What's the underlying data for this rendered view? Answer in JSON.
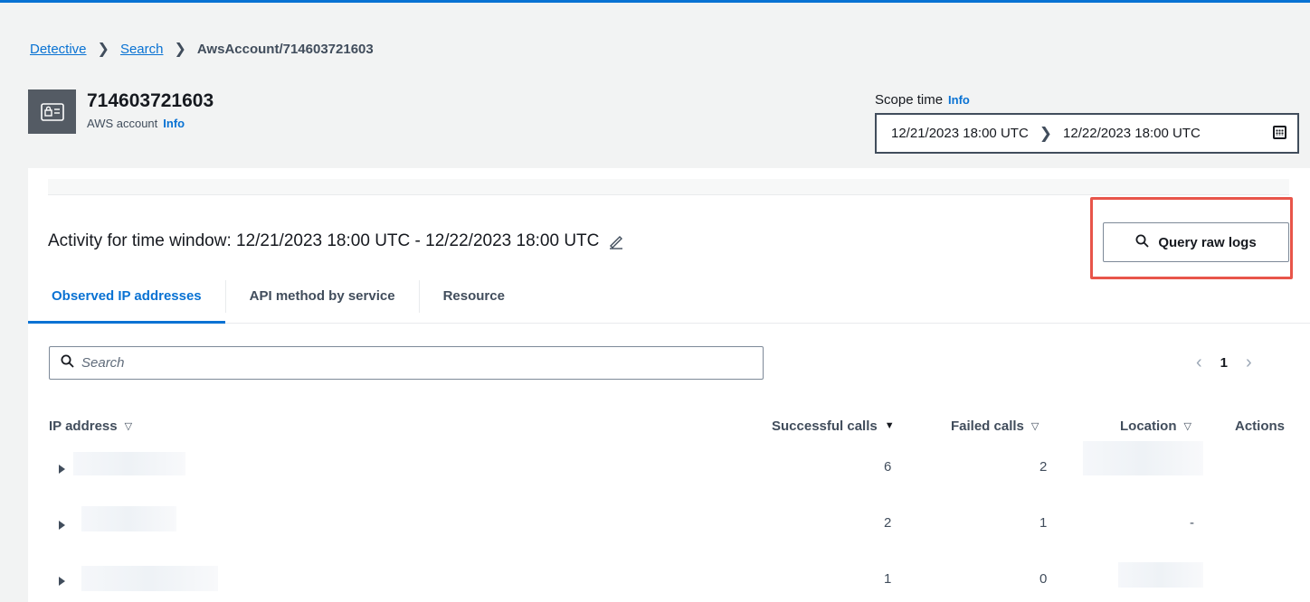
{
  "breadcrumb": {
    "items": [
      "Detective",
      "Search",
      "AwsAccount/714603721603"
    ]
  },
  "account": {
    "id": "714603721603",
    "type_label": "AWS account",
    "info_label": "Info"
  },
  "scope": {
    "label": "Scope time",
    "info_label": "Info",
    "start": "12/21/2023 18:00 UTC",
    "end": "12/22/2023 18:00 UTC"
  },
  "activity": {
    "title": "Activity for time window: 12/21/2023 18:00 UTC - 12/22/2023 18:00 UTC",
    "query_button_label": "Query raw logs"
  },
  "tabs": [
    {
      "label": "Observed IP addresses",
      "active": true
    },
    {
      "label": "API method by service",
      "active": false
    },
    {
      "label": "Resource",
      "active": false
    }
  ],
  "search": {
    "placeholder": "Search"
  },
  "pagination": {
    "current_page": "1"
  },
  "table": {
    "columns": {
      "ip": "IP address",
      "successful": "Successful calls",
      "failed": "Failed calls",
      "location": "Location",
      "actions": "Actions"
    },
    "rows": [
      {
        "successful": "6",
        "failed": "2",
        "location": ""
      },
      {
        "successful": "2",
        "failed": "1",
        "location": "-"
      },
      {
        "successful": "1",
        "failed": "0",
        "location": ""
      }
    ]
  },
  "colors": {
    "accent": "#0972d3",
    "highlight": "#e8554a"
  }
}
